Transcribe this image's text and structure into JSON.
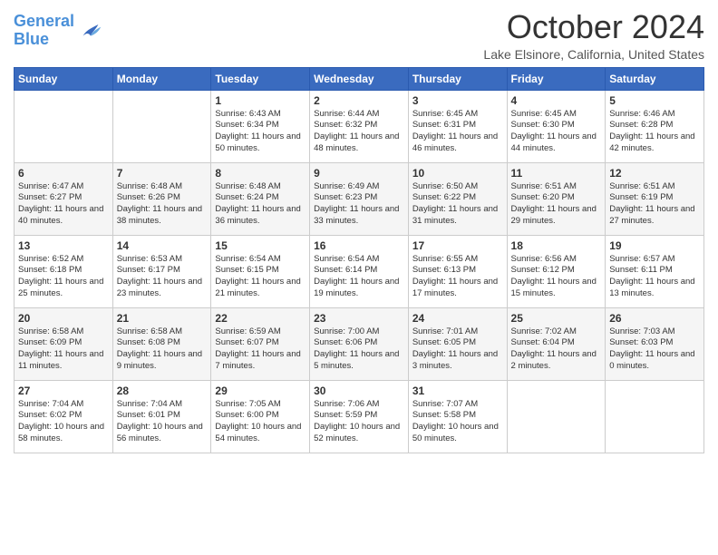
{
  "header": {
    "logo_line1": "General",
    "logo_line2": "Blue",
    "month_title": "October 2024",
    "location": "Lake Elsinore, California, United States"
  },
  "days_of_week": [
    "Sunday",
    "Monday",
    "Tuesday",
    "Wednesday",
    "Thursday",
    "Friday",
    "Saturday"
  ],
  "weeks": [
    [
      {
        "day": "",
        "info": ""
      },
      {
        "day": "",
        "info": ""
      },
      {
        "day": "1",
        "info": "Sunrise: 6:43 AM\nSunset: 6:34 PM\nDaylight: 11 hours and 50 minutes."
      },
      {
        "day": "2",
        "info": "Sunrise: 6:44 AM\nSunset: 6:32 PM\nDaylight: 11 hours and 48 minutes."
      },
      {
        "day": "3",
        "info": "Sunrise: 6:45 AM\nSunset: 6:31 PM\nDaylight: 11 hours and 46 minutes."
      },
      {
        "day": "4",
        "info": "Sunrise: 6:45 AM\nSunset: 6:30 PM\nDaylight: 11 hours and 44 minutes."
      },
      {
        "day": "5",
        "info": "Sunrise: 6:46 AM\nSunset: 6:28 PM\nDaylight: 11 hours and 42 minutes."
      }
    ],
    [
      {
        "day": "6",
        "info": "Sunrise: 6:47 AM\nSunset: 6:27 PM\nDaylight: 11 hours and 40 minutes."
      },
      {
        "day": "7",
        "info": "Sunrise: 6:48 AM\nSunset: 6:26 PM\nDaylight: 11 hours and 38 minutes."
      },
      {
        "day": "8",
        "info": "Sunrise: 6:48 AM\nSunset: 6:24 PM\nDaylight: 11 hours and 36 minutes."
      },
      {
        "day": "9",
        "info": "Sunrise: 6:49 AM\nSunset: 6:23 PM\nDaylight: 11 hours and 33 minutes."
      },
      {
        "day": "10",
        "info": "Sunrise: 6:50 AM\nSunset: 6:22 PM\nDaylight: 11 hours and 31 minutes."
      },
      {
        "day": "11",
        "info": "Sunrise: 6:51 AM\nSunset: 6:20 PM\nDaylight: 11 hours and 29 minutes."
      },
      {
        "day": "12",
        "info": "Sunrise: 6:51 AM\nSunset: 6:19 PM\nDaylight: 11 hours and 27 minutes."
      }
    ],
    [
      {
        "day": "13",
        "info": "Sunrise: 6:52 AM\nSunset: 6:18 PM\nDaylight: 11 hours and 25 minutes."
      },
      {
        "day": "14",
        "info": "Sunrise: 6:53 AM\nSunset: 6:17 PM\nDaylight: 11 hours and 23 minutes."
      },
      {
        "day": "15",
        "info": "Sunrise: 6:54 AM\nSunset: 6:15 PM\nDaylight: 11 hours and 21 minutes."
      },
      {
        "day": "16",
        "info": "Sunrise: 6:54 AM\nSunset: 6:14 PM\nDaylight: 11 hours and 19 minutes."
      },
      {
        "day": "17",
        "info": "Sunrise: 6:55 AM\nSunset: 6:13 PM\nDaylight: 11 hours and 17 minutes."
      },
      {
        "day": "18",
        "info": "Sunrise: 6:56 AM\nSunset: 6:12 PM\nDaylight: 11 hours and 15 minutes."
      },
      {
        "day": "19",
        "info": "Sunrise: 6:57 AM\nSunset: 6:11 PM\nDaylight: 11 hours and 13 minutes."
      }
    ],
    [
      {
        "day": "20",
        "info": "Sunrise: 6:58 AM\nSunset: 6:09 PM\nDaylight: 11 hours and 11 minutes."
      },
      {
        "day": "21",
        "info": "Sunrise: 6:58 AM\nSunset: 6:08 PM\nDaylight: 11 hours and 9 minutes."
      },
      {
        "day": "22",
        "info": "Sunrise: 6:59 AM\nSunset: 6:07 PM\nDaylight: 11 hours and 7 minutes."
      },
      {
        "day": "23",
        "info": "Sunrise: 7:00 AM\nSunset: 6:06 PM\nDaylight: 11 hours and 5 minutes."
      },
      {
        "day": "24",
        "info": "Sunrise: 7:01 AM\nSunset: 6:05 PM\nDaylight: 11 hours and 3 minutes."
      },
      {
        "day": "25",
        "info": "Sunrise: 7:02 AM\nSunset: 6:04 PM\nDaylight: 11 hours and 2 minutes."
      },
      {
        "day": "26",
        "info": "Sunrise: 7:03 AM\nSunset: 6:03 PM\nDaylight: 11 hours and 0 minutes."
      }
    ],
    [
      {
        "day": "27",
        "info": "Sunrise: 7:04 AM\nSunset: 6:02 PM\nDaylight: 10 hours and 58 minutes."
      },
      {
        "day": "28",
        "info": "Sunrise: 7:04 AM\nSunset: 6:01 PM\nDaylight: 10 hours and 56 minutes."
      },
      {
        "day": "29",
        "info": "Sunrise: 7:05 AM\nSunset: 6:00 PM\nDaylight: 10 hours and 54 minutes."
      },
      {
        "day": "30",
        "info": "Sunrise: 7:06 AM\nSunset: 5:59 PM\nDaylight: 10 hours and 52 minutes."
      },
      {
        "day": "31",
        "info": "Sunrise: 7:07 AM\nSunset: 5:58 PM\nDaylight: 10 hours and 50 minutes."
      },
      {
        "day": "",
        "info": ""
      },
      {
        "day": "",
        "info": ""
      }
    ]
  ]
}
